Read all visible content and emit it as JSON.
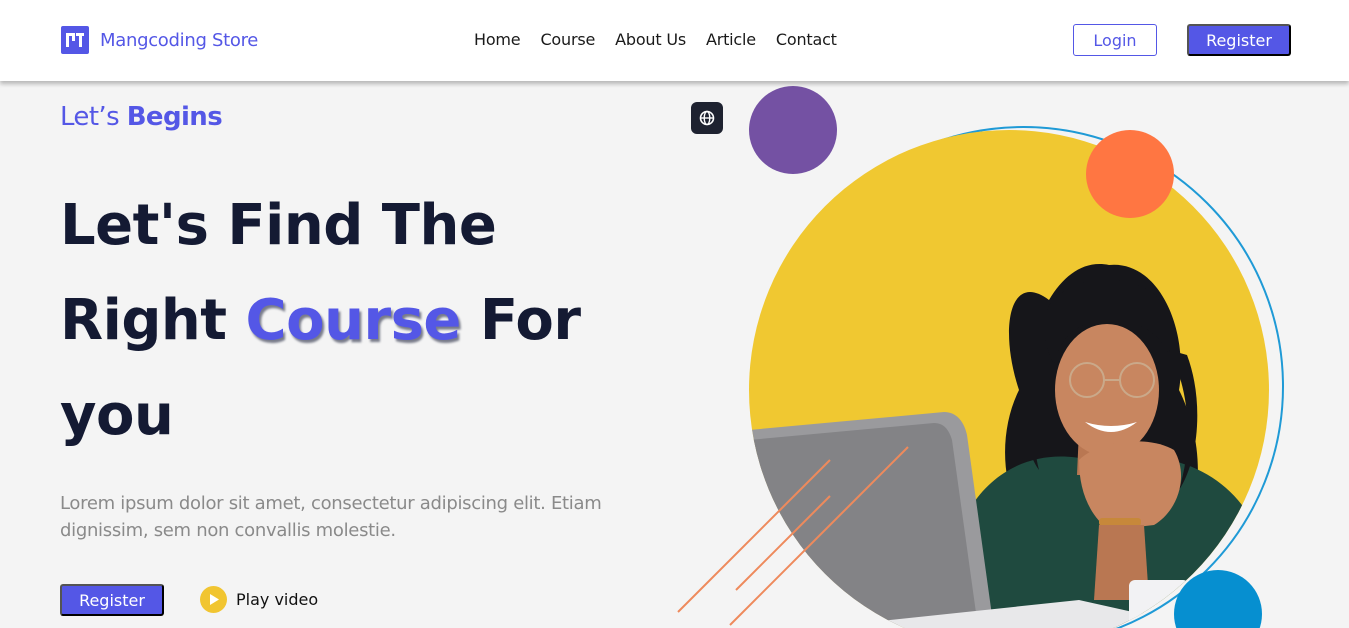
{
  "brand": {
    "name": "Mangcoding Store",
    "logo_icon": "store-logo-icon",
    "color": "#5457e6"
  },
  "nav": {
    "links": [
      "Home",
      "Course",
      "About Us",
      "Article",
      "Contact"
    ]
  },
  "auth": {
    "login_label": "Login",
    "register_label": "Register"
  },
  "hero": {
    "kicker_prefix": "Let’s ",
    "kicker_strong": "Begins",
    "headline_line1": "Let's Find The",
    "headline_line2_pre": "Right ",
    "headline_accent": "Course",
    "headline_line2_post": " For",
    "headline_line3": "you",
    "description": "Lorem ipsum dolor sit amet, consectetur adipiscing elit. Etiam dignissim, sem non convallis molestie.",
    "cta_label": "Register",
    "play_label": "Play video",
    "play_icon": "play-icon"
  },
  "colors": {
    "accent": "#5457e6",
    "heading": "#141a33",
    "yellow": "#f0c831",
    "purple": "#7451a3",
    "orange": "#ff7642",
    "blue": "#068fd0"
  }
}
